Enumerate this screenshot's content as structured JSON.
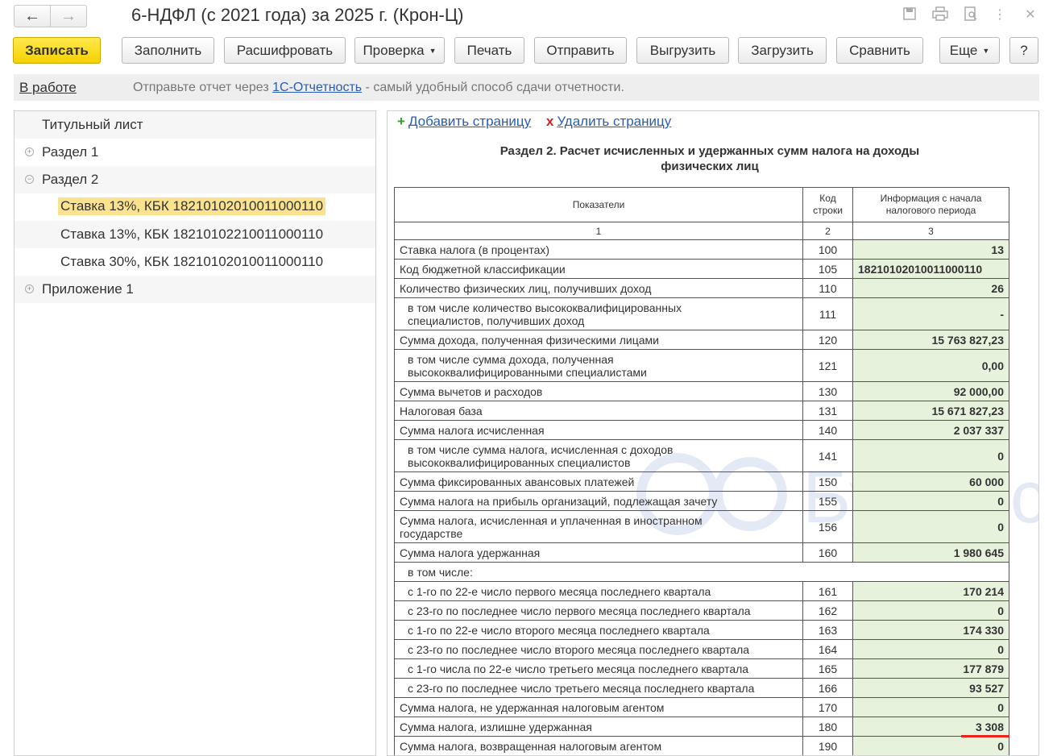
{
  "window": {
    "title": "6-НДФЛ (с 2021 года) за 2025 г. (Крон-Ц)"
  },
  "toolbar": {
    "save": "Записать",
    "fill": "Заполнить",
    "decode": "Расшифровать",
    "check": "Проверка",
    "print": "Печать",
    "send": "Отправить",
    "export": "Выгрузить",
    "import": "Загрузить",
    "compare": "Сравнить",
    "more": "Еще",
    "help": "?"
  },
  "infobar": {
    "status": "В работе",
    "text_before": "Отправьте отчет через ",
    "link": "1С-Отчетность",
    "text_after": " - самый удобный способ сдачи отчетности."
  },
  "tree": {
    "items": [
      {
        "label": "Титульный лист"
      },
      {
        "label": "Раздел 1",
        "toggle": "+"
      },
      {
        "label": "Раздел 2",
        "toggle": "−"
      },
      {
        "label": "Ставка 13%, КБК 18210102010011000110"
      },
      {
        "label": "Ставка 13%, КБК 18210102210011000110"
      },
      {
        "label": "Ставка 30%, КБК 18210102010011000110"
      },
      {
        "label": "Приложение 1",
        "toggle": "+"
      }
    ]
  },
  "page_actions": {
    "add": "Добавить страницу",
    "delete": "Удалить страницу"
  },
  "section": {
    "title_line1": "Раздел 2. Расчет исчисленных и удержанных сумм налога на доходы",
    "title_line2": "физических лиц"
  },
  "table": {
    "header": {
      "col1": "Показатели",
      "col2_line1": "Код",
      "col2_line2": "строки",
      "col3_line1": "Информация с начала",
      "col3_line2": "налогового периода",
      "num1": "1",
      "num2": "2",
      "num3": "3"
    },
    "rows": [
      {
        "label": "Ставка налога (в процентах)",
        "code": "100",
        "value": "13"
      },
      {
        "label": "Код бюджетной классификации",
        "code": "105",
        "value": "18210102010011000110"
      },
      {
        "label": "Количество физических лиц, получивших доход",
        "code": "110",
        "value": "26"
      },
      {
        "label1": "в том числе количество высококвалифицированных",
        "label2": "специалистов, получивших доход",
        "code": "111",
        "value": "-"
      },
      {
        "label": "Сумма дохода, полученная физическими лицами",
        "code": "120",
        "value": "15 763 827,23"
      },
      {
        "label1": "в том числе сумма дохода, полученная",
        "label2": "высококвалифицированными специалистами",
        "code": "121",
        "value": "0,00"
      },
      {
        "label": "Сумма вычетов и расходов",
        "code": "130",
        "value": "92 000,00"
      },
      {
        "label": "Налоговая база",
        "code": "131",
        "value": "15 671 827,23"
      },
      {
        "label": "Сумма налога исчисленная",
        "code": "140",
        "value": "2 037 337"
      },
      {
        "label1": "в том числе сумма налога, исчисленная с доходов",
        "label2": "высококвалифицированных специалистов",
        "code": "141",
        "value": "0"
      },
      {
        "label": "Сумма фиксированных авансовых платежей",
        "code": "150",
        "value": "60 000"
      },
      {
        "label": "Сумма налога на прибыль организаций, подлежащая зачету",
        "code": "155",
        "value": "0"
      },
      {
        "label1": "Сумма налога, исчисленная и уплаченная в иностранном",
        "label2": "государстве",
        "code": "156",
        "value": "0"
      },
      {
        "label": "Сумма налога удержанная",
        "code": "160",
        "value": "1 980 645"
      },
      {
        "label": "в том числе:"
      },
      {
        "label": "с 1-го по 22-е число первого месяца последнего квартала",
        "code": "161",
        "value": "170 214"
      },
      {
        "label": "с 23-го по последнее число первого месяца последнего квартала",
        "code": "162",
        "value": "0"
      },
      {
        "label": "с 1-го по 22-е число второго месяца последнего квартала",
        "code": "163",
        "value": "174 330"
      },
      {
        "label": "с 23-го по последнее число второго месяца последнего квартала",
        "code": "164",
        "value": "0"
      },
      {
        "label": "с 1-го числа по 22-е число третьего месяца последнего квартала",
        "code": "165",
        "value": "177 879"
      },
      {
        "label": "с 23-го по последнее число третьего месяца последнего квартала",
        "code": "166",
        "value": "93 527"
      },
      {
        "label": "Сумма налога, не удержанная налоговым агентом",
        "code": "170",
        "value": "0"
      },
      {
        "label": "Сумма налога, излишне удержанная",
        "code": "180",
        "value": "3 308"
      },
      {
        "label": "Сумма налога, возвращенная налоговым агентом",
        "code": "190",
        "value": "0"
      }
    ]
  },
  "watermark": {
    "text": "БухЭксперт"
  },
  "colors": {
    "accent_yellow": "#f5d100",
    "value_cell": "#e6f2dc",
    "selected_tree": "#fbe28f",
    "link": "#2a5db0",
    "highlight_red": "#e8241b"
  }
}
